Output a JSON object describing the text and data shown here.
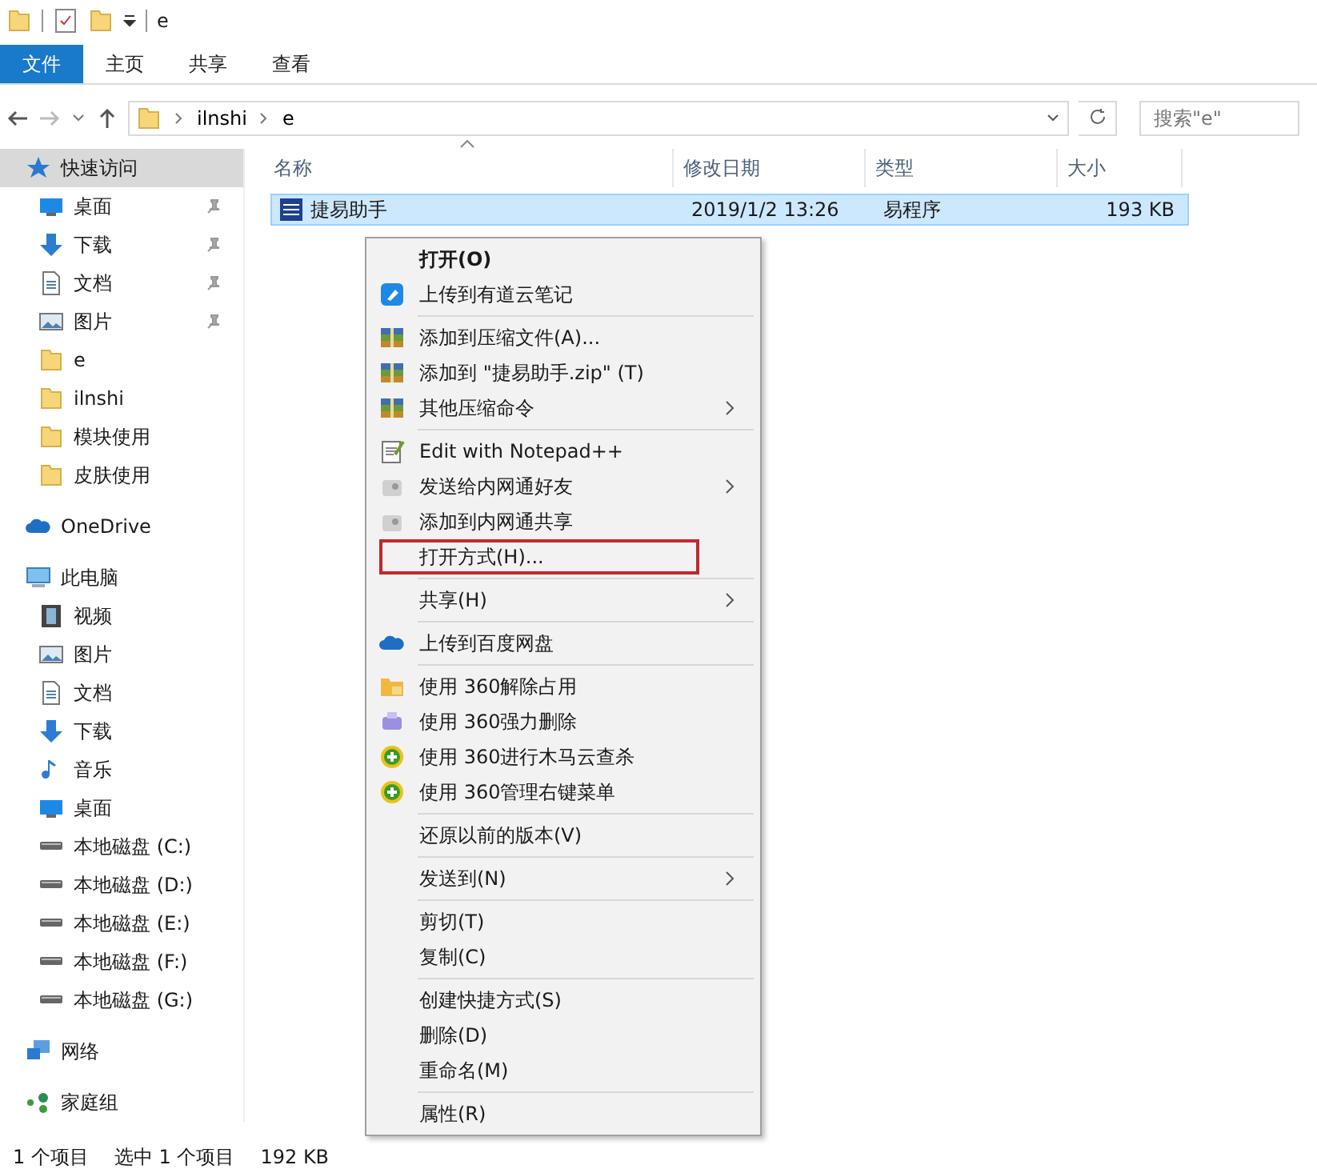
{
  "window": {
    "title": "e"
  },
  "ribbon_tabs": [
    {
      "label": "文件",
      "selected": true
    },
    {
      "label": "主页",
      "selected": false
    },
    {
      "label": "共享",
      "selected": false
    },
    {
      "label": "查看",
      "selected": false
    }
  ],
  "address": {
    "path": [
      "ilnshi",
      "e"
    ],
    "search": {
      "placeholder": "搜索\"e\""
    }
  },
  "sidebar": {
    "items": [
      {
        "label": "快速访问",
        "selected": true,
        "children": [
          {
            "label": "桌面",
            "pinned": true
          },
          {
            "label": "下载",
            "pinned": true
          },
          {
            "label": "文档",
            "pinned": true
          },
          {
            "label": "图片",
            "pinned": true
          },
          {
            "label": "e",
            "pinned": false
          },
          {
            "label": "ilnshi",
            "pinned": false
          },
          {
            "label": "模块使用",
            "pinned": false
          },
          {
            "label": "皮肤使用",
            "pinned": false
          }
        ]
      },
      {
        "label": "OneDrive",
        "selected": false
      },
      {
        "label": "此电脑",
        "selected": false,
        "children": [
          {
            "label": "视频",
            "pinned": false
          },
          {
            "label": "图片",
            "pinned": false
          },
          {
            "label": "文档",
            "pinned": false
          },
          {
            "label": "下载",
            "pinned": false
          },
          {
            "label": "音乐",
            "pinned": false
          },
          {
            "label": "桌面",
            "pinned": false
          },
          {
            "label": "本地磁盘 (C:)",
            "pinned": false
          },
          {
            "label": "本地磁盘 (D:)",
            "pinned": false
          },
          {
            "label": "本地磁盘 (E:)",
            "pinned": false
          },
          {
            "label": "本地磁盘 (F:)",
            "pinned": false
          },
          {
            "label": "本地磁盘 (G:)",
            "pinned": false
          }
        ]
      },
      {
        "label": "网络",
        "selected": false
      },
      {
        "label": "家庭组",
        "selected": false
      }
    ]
  },
  "table": {
    "columns": [
      "名称",
      "修改日期",
      "类型",
      "大小"
    ],
    "rows": [
      {
        "name": "捷易助手",
        "modified": "2019/1/2 13:26",
        "type": "易程序",
        "size": "193 KB",
        "selected": true
      }
    ]
  },
  "context_menu": {
    "items": [
      {
        "kind": "item",
        "label": "打开(O)",
        "bold": true,
        "submenu": false,
        "highlighted": false
      },
      {
        "kind": "item",
        "label": "上传到有道云笔记",
        "bold": false,
        "submenu": false,
        "highlighted": false
      },
      {
        "kind": "separator"
      },
      {
        "kind": "item",
        "label": "添加到压缩文件(A)...",
        "bold": false,
        "submenu": false,
        "highlighted": false
      },
      {
        "kind": "item",
        "label": "添加到 \"捷易助手.zip\" (T)",
        "bold": false,
        "submenu": false,
        "highlighted": false
      },
      {
        "kind": "item",
        "label": "其他压缩命令",
        "bold": false,
        "submenu": true,
        "highlighted": false
      },
      {
        "kind": "separator"
      },
      {
        "kind": "item",
        "label": "Edit with Notepad++",
        "bold": false,
        "submenu": false,
        "highlighted": false
      },
      {
        "kind": "item",
        "label": "发送给内网通好友",
        "bold": false,
        "submenu": true,
        "highlighted": false
      },
      {
        "kind": "item",
        "label": "添加到内网通共享",
        "bold": false,
        "submenu": false,
        "highlighted": false
      },
      {
        "kind": "item",
        "label": "打开方式(H)...",
        "bold": false,
        "submenu": false,
        "highlighted": true
      },
      {
        "kind": "separator"
      },
      {
        "kind": "item",
        "label": "共享(H)",
        "bold": false,
        "submenu": true,
        "highlighted": false
      },
      {
        "kind": "separator"
      },
      {
        "kind": "item",
        "label": "上传到百度网盘",
        "bold": false,
        "submenu": false,
        "highlighted": false
      },
      {
        "kind": "separator"
      },
      {
        "kind": "item",
        "label": "使用 360解除占用",
        "bold": false,
        "submenu": false,
        "highlighted": false
      },
      {
        "kind": "item",
        "label": "使用 360强力删除",
        "bold": false,
        "submenu": false,
        "highlighted": false
      },
      {
        "kind": "item",
        "label": "使用 360进行木马云查杀",
        "bold": false,
        "submenu": false,
        "highlighted": false
      },
      {
        "kind": "item",
        "label": "使用 360管理右键菜单",
        "bold": false,
        "submenu": false,
        "highlighted": false
      },
      {
        "kind": "separator"
      },
      {
        "kind": "item",
        "label": "还原以前的版本(V)",
        "bold": false,
        "submenu": false,
        "highlighted": false
      },
      {
        "kind": "separator"
      },
      {
        "kind": "item",
        "label": "发送到(N)",
        "bold": false,
        "submenu": true,
        "highlighted": false
      },
      {
        "kind": "separator"
      },
      {
        "kind": "item",
        "label": "剪切(T)",
        "bold": false,
        "submenu": false,
        "highlighted": false
      },
      {
        "kind": "item",
        "label": "复制(C)",
        "bold": false,
        "submenu": false,
        "highlighted": false
      },
      {
        "kind": "separator"
      },
      {
        "kind": "item",
        "label": "创建快捷方式(S)",
        "bold": false,
        "submenu": false,
        "highlighted": false
      },
      {
        "kind": "item",
        "label": "删除(D)",
        "bold": false,
        "submenu": false,
        "highlighted": false
      },
      {
        "kind": "item",
        "label": "重命名(M)",
        "bold": false,
        "submenu": false,
        "highlighted": false
      },
      {
        "kind": "separator"
      },
      {
        "kind": "item",
        "label": "属性(R)",
        "bold": false,
        "submenu": false,
        "highlighted": false
      }
    ]
  },
  "status_bar": [
    "1 个项目",
    "选中 1 个项目",
    "192 KB"
  ]
}
